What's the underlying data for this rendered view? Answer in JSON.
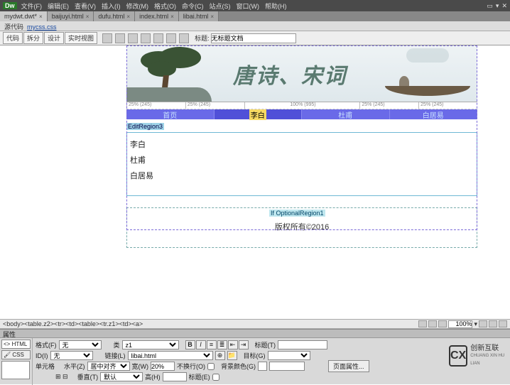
{
  "menubar": {
    "logo": "Dw",
    "items": [
      "文件(F)",
      "编辑(E)",
      "查看(V)",
      "插入(I)",
      "修改(M)",
      "格式(O)",
      "命令(C)",
      "站点(S)",
      "窗口(W)",
      "帮助(H)"
    ]
  },
  "filetabs": {
    "tabs": [
      {
        "label": "mydwt.dwt*",
        "active": true
      },
      {
        "label": "baijuyi.html",
        "active": false
      },
      {
        "label": "dufu.html",
        "active": false
      },
      {
        "label": "index.html",
        "active": false
      },
      {
        "label": "libai.html",
        "active": false
      }
    ]
  },
  "subbar": {
    "prefix": "源代码",
    "css": "mycss.css"
  },
  "viewbar": {
    "modes": [
      "代码",
      "拆分",
      "设计",
      "实时视图"
    ],
    "title_label": "标题:",
    "title_value": "无标题文档"
  },
  "banner": {
    "title": "唐诗、宋词"
  },
  "ruler": [
    "25% (245)",
    "25% (245)",
    "100% (995)",
    "25% (245)",
    "25% (245)"
  ],
  "nav": {
    "items": [
      "首页",
      "李白",
      "杜甫",
      "白居易"
    ],
    "selected_index": 1
  },
  "edit_region": {
    "label": "EditRegion3",
    "lines": [
      "李白",
      "杜甫",
      "白居易"
    ]
  },
  "optional": {
    "label": "If OptionalRegion1",
    "copyright": "版权所有©2016"
  },
  "tag_selector": "<body><table.z2><tr><td><table><tr.z1><td><a>",
  "status": {
    "zoom": "100%"
  },
  "properties": {
    "header": "属性",
    "modes": {
      "html": "<> HTML",
      "css": "🖌 CSS"
    },
    "row1": {
      "format_lbl": "格式(F)",
      "format_val": "无",
      "class_lbl": "类",
      "class_val": "z1",
      "title_lbl": "标题(T)",
      "title_val": ""
    },
    "row2": {
      "id_lbl": "ID(I)",
      "id_val": "无",
      "link_lbl": "链接(L)",
      "link_val": "libai.html",
      "target_lbl": "目标(G)",
      "target_val": ""
    },
    "row3": {
      "cell_lbl": "单元格",
      "horz_lbl": "水平(Z)",
      "horz_val": "居中对齐",
      "width_lbl": "宽(W)",
      "width_val": "20%",
      "nowrap_lbl": "不换行(O)",
      "bg_lbl": "背景颜色(G)",
      "pageprops": "页面属性..."
    },
    "row4": {
      "vert_lbl": "垂直(T)",
      "vert_val": "默认",
      "height_lbl": "高(H)",
      "height_val": "",
      "header_lbl": "标题(E)"
    }
  },
  "brand": {
    "mark": "CX",
    "cn": "创新互联",
    "en": "CHUANG XIN HU LIAN"
  }
}
